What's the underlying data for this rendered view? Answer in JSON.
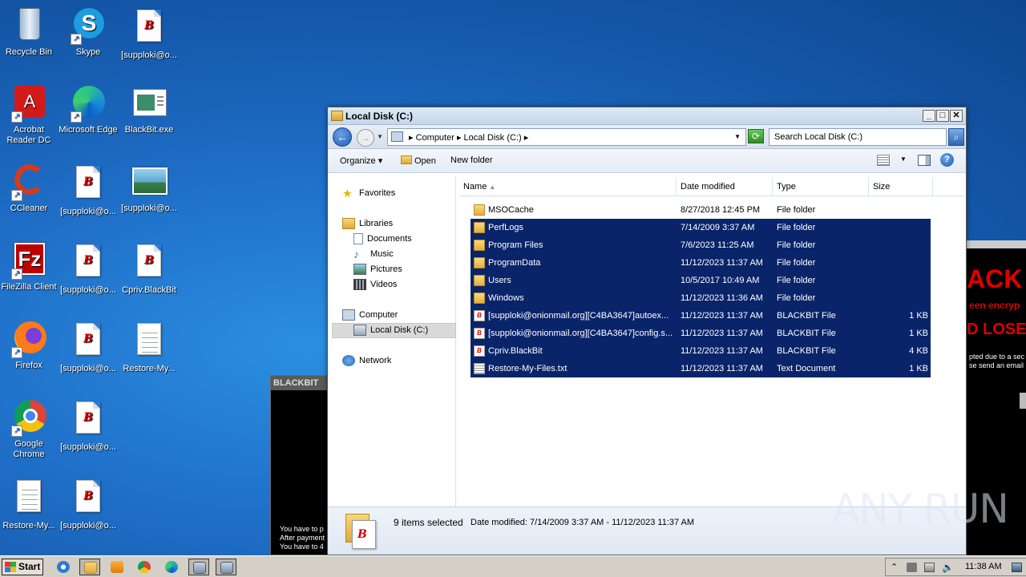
{
  "desktop_icons": [
    {
      "label": "Recycle Bin"
    },
    {
      "label": "Skype"
    },
    {
      "label": "[supploki@o..."
    },
    {
      "label": "Acrobat Reader DC"
    },
    {
      "label": "Microsoft Edge"
    },
    {
      "label": "BlackBit.exe"
    },
    {
      "label": "CCleaner"
    },
    {
      "label": "[supploki@o..."
    },
    {
      "label": "[supploki@o..."
    },
    {
      "label": "FileZilla Client"
    },
    {
      "label": "[supploki@o..."
    },
    {
      "label": "Cpriv.BlackBit"
    },
    {
      "label": "Firefox"
    },
    {
      "label": "[supploki@o..."
    },
    {
      "label": "Restore-My..."
    },
    {
      "label": "Google Chrome"
    },
    {
      "label": "[supploki@o..."
    },
    {
      "label": "Restore-My..."
    },
    {
      "label": "[supploki@o..."
    }
  ],
  "blackbit_window": {
    "title": "BLACKBIT",
    "lines": [
      "You have to p",
      "After payment",
      "You have to 4"
    ]
  },
  "blackbit_right": {
    "big": "ACK I",
    "sub": "een encryp",
    "lose": "D LOSE A",
    "lines": [
      "pted due to a sec",
      "se send an email"
    ]
  },
  "explorer": {
    "title": "Local Disk (C:)",
    "address": [
      "Computer",
      "Local Disk (C:)"
    ],
    "search_placeholder": "Search Local Disk (C:)",
    "toolbar": {
      "organize": "Organize",
      "open": "Open",
      "new_folder": "New folder"
    },
    "nav": {
      "favorites": "Favorites",
      "libraries": "Libraries",
      "documents": "Documents",
      "music": "Music",
      "pictures": "Pictures",
      "videos": "Videos",
      "computer": "Computer",
      "local_disk": "Local Disk (C:)",
      "network": "Network"
    },
    "columns": {
      "name": "Name",
      "date": "Date modified",
      "type": "Type",
      "size": "Size"
    },
    "files": [
      {
        "name": "MSOCache",
        "date": "8/27/2018 12:45 PM",
        "type": "File folder",
        "size": "",
        "icon": "locked-folder-icon",
        "selected": false
      },
      {
        "name": "PerfLogs",
        "date": "7/14/2009 3:37 AM",
        "type": "File folder",
        "size": "",
        "icon": "folder-icon",
        "selected": true
      },
      {
        "name": "Program Files",
        "date": "7/6/2023 11:25 AM",
        "type": "File folder",
        "size": "",
        "icon": "folder-icon",
        "selected": true
      },
      {
        "name": "ProgramData",
        "date": "11/12/2023 11:37 AM",
        "type": "File folder",
        "size": "",
        "icon": "folder-icon",
        "selected": true
      },
      {
        "name": "Users",
        "date": "10/5/2017 10:49 AM",
        "type": "File folder",
        "size": "",
        "icon": "folder-icon",
        "selected": true
      },
      {
        "name": "Windows",
        "date": "11/12/2023 11:36 AM",
        "type": "File folder",
        "size": "",
        "icon": "folder-icon",
        "selected": true
      },
      {
        "name": "[supploki@onionmail.org][C4BA3647]autoex...",
        "date": "11/12/2023 11:37 AM",
        "type": "BLACKBIT File",
        "size": "1 KB",
        "icon": "blackbit-file-icon",
        "selected": true
      },
      {
        "name": "[supploki@onionmail.org][C4BA3647]config.s...",
        "date": "11/12/2023 11:37 AM",
        "type": "BLACKBIT File",
        "size": "1 KB",
        "icon": "blackbit-file-icon",
        "selected": true
      },
      {
        "name": "Cpriv.BlackBit",
        "date": "11/12/2023 11:37 AM",
        "type": "BLACKBIT File",
        "size": "4 KB",
        "icon": "blackbit-file-icon",
        "selected": true
      },
      {
        "name": "Restore-My-Files.txt",
        "date": "11/12/2023 11:37 AM",
        "type": "Text Document",
        "size": "1 KB",
        "icon": "text-file-icon",
        "selected": true
      }
    ],
    "status": {
      "count": "9 items selected",
      "date": "Date modified: 7/14/2009 3:37 AM - 11/12/2023 11:37 AM"
    }
  },
  "watermark": "ANY RUN",
  "taskbar": {
    "start": "Start",
    "clock": "11:38 AM"
  }
}
